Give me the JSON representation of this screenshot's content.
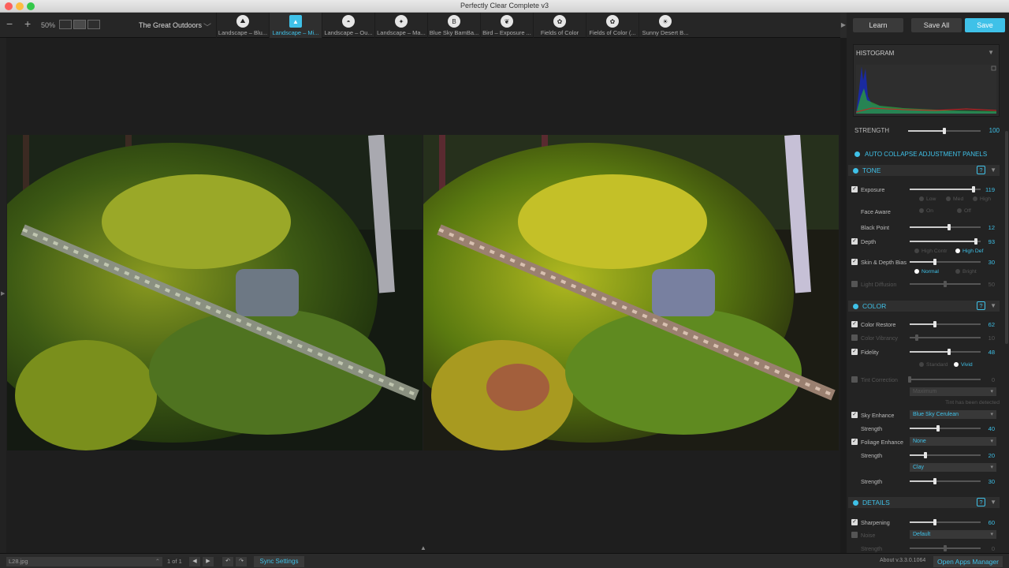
{
  "window": {
    "title": "Perfectly Clear Complete v3"
  },
  "toolbar": {
    "zoom": "50%",
    "preset_group": "The Great Outdoors",
    "presets": [
      {
        "label": "Landscape – Blu...",
        "icon": "mountain-sun-icon",
        "selected": false
      },
      {
        "label": "Landscape – Mi...",
        "icon": "landscape-icon",
        "selected": true
      },
      {
        "label": "Landscape – Ou...",
        "icon": "circle-mountain-icon",
        "selected": false
      },
      {
        "label": "Landscape – Ma...",
        "icon": "wand-icon",
        "selected": false
      },
      {
        "label": "Blue Sky BamBa...",
        "icon": "bam-bubble-icon",
        "selected": false
      },
      {
        "label": "Bird – Exposure ...",
        "icon": "bird-icon",
        "selected": false
      },
      {
        "label": "Fields of Color",
        "icon": "flowers-icon",
        "selected": false
      },
      {
        "label": "Fields of Color (...",
        "icon": "flowers-icon",
        "selected": false
      },
      {
        "label": "Sunny Desert B...",
        "icon": "sun-cactus-icon",
        "selected": false
      }
    ]
  },
  "panel": {
    "learn": "Learn",
    "save_all": "Save All",
    "save": "Save",
    "histogram": "HISTOGRAM",
    "strength_label": "STRENGTH",
    "strength_value": "100",
    "auto_collapse": "AUTO COLLAPSE ADJUSTMENT PANELS",
    "tone": {
      "title": "TONE",
      "exposure": {
        "label": "Exposure",
        "value": "119",
        "pos": 0.9
      },
      "exposure_opts": [
        "Low",
        "Med",
        "High"
      ],
      "face_aware": "Face Aware",
      "face_opts": [
        "On",
        "Off"
      ],
      "black_point": {
        "label": "Black Point",
        "value": "12",
        "pos": 0.55
      },
      "depth": {
        "label": "Depth",
        "value": "93",
        "pos": 0.93
      },
      "depth_opts": [
        "High Contr",
        "High Def"
      ],
      "skin": {
        "label": "Skin & Depth Bias",
        "value": "30",
        "pos": 0.35
      },
      "skin_opts": [
        "Normal",
        "Bright"
      ],
      "light": {
        "label": "Light Diffusion",
        "value": "50",
        "pos": 0.5
      }
    },
    "color": {
      "title": "COLOR",
      "restore": {
        "label": "Color Restore",
        "value": "62",
        "pos": 0.35
      },
      "vibrancy": {
        "label": "Color Vibrancy",
        "value": "10",
        "pos": 0.1
      },
      "fidelity": {
        "label": "Fidelity",
        "value": "48",
        "pos": 0.55
      },
      "fidelity_opts": [
        "Standard",
        "Vivid"
      ],
      "tint": {
        "label": "Tint Correction",
        "value": "0",
        "pos": 0.0
      },
      "tint_mode": "Maximum",
      "tint_note": "Tint has been detected",
      "sky": {
        "label": "Sky Enhance",
        "value": "Blue Sky Cerulean"
      },
      "sky_strength": {
        "label": "Strength",
        "value": "40",
        "pos": 0.4
      },
      "foliage": {
        "label": "Foliage Enhance",
        "value": "None"
      },
      "foliage_strength": {
        "label": "Strength",
        "value": "20",
        "pos": 0.22
      },
      "foliage_style": "Clay",
      "style_strength": {
        "label": "Strength",
        "value": "30",
        "pos": 0.35
      }
    },
    "details": {
      "title": "DETAILS",
      "sharpening": {
        "label": "Sharpening",
        "value": "60",
        "pos": 0.35
      },
      "noise": {
        "label": "Noise",
        "value": "Default"
      },
      "noise_strength": {
        "label": "Strength",
        "value": "0",
        "pos": 0.5
      }
    }
  },
  "bottom": {
    "filename": "L28.jpg",
    "page": "1 of 1",
    "sync": "Sync Settings",
    "about": "About v.3.3.0.1064",
    "apps": "Open Apps Manager"
  }
}
